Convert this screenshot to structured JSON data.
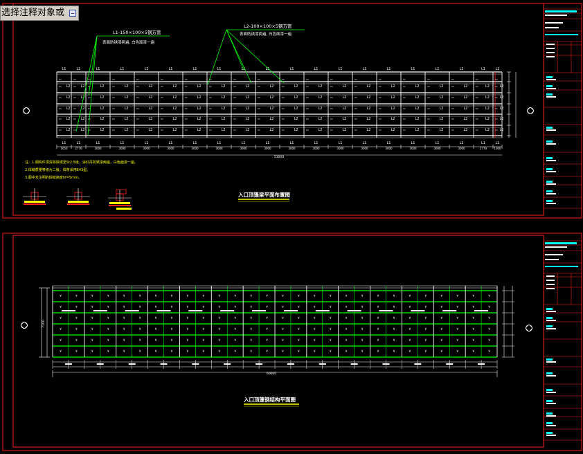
{
  "command": {
    "prompt_text": "选择注释对象或",
    "expand_icon": "plus-box-icon"
  },
  "colors": {
    "background": "#000000",
    "frame": "#ff2020",
    "members": "#ffffff",
    "leaders": "#00ff00",
    "title_text": "#ffffff",
    "title_underline": "#ffff00",
    "notes": "#ffff00",
    "titleblock_accent": "#00ffff"
  },
  "drawing1": {
    "note_L1": "L1-150×100×5钢方管",
    "note_L1_sub": "表面防锈漆两遍, 白色面漆一遍",
    "note_L2": "L2-100×100×5钢方管",
    "note_L2_sub": "表面防锈漆两遍, 白色面漆一遍",
    "member_L1": "L1",
    "member_L2": "L2",
    "bay_dims": [
      "1650",
      "2770",
      "3000",
      "3000",
      "3000",
      "3000",
      "3000",
      "3000",
      "3000",
      "3000",
      "3000",
      "3000",
      "3000",
      "3000",
      "3000",
      "3000",
      "3000",
      "3000",
      "2770",
      "1000"
    ],
    "total_dim": "51000",
    "title": "入口顶篷梁平面布置图",
    "spec_notes": [
      "注：1.钢构件须清除铁锈至St2.5级，涂红丹防锈漆两遍，白色面漆一遍。",
      "2.焊缝质量等级为二级，焊条采用E43型。",
      "3.图中未注明的焊缝高度hf=5mm。"
    ]
  },
  "drawing2": {
    "title": "入口顶篷钢结构平面图",
    "total_dim": "60000",
    "left_dim": "7100"
  }
}
